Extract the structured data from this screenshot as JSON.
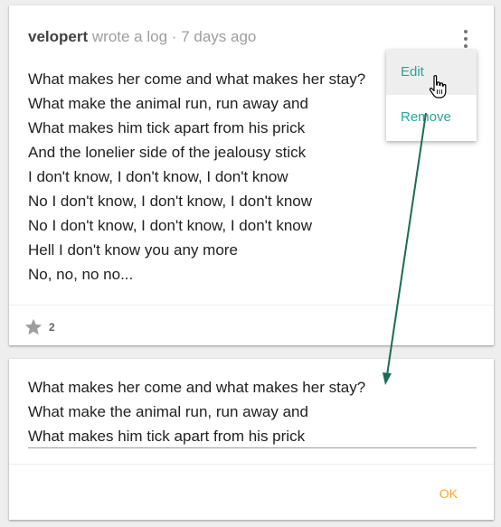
{
  "memo": {
    "author": "velopert",
    "action_text": "wrote a log",
    "separator": "·",
    "time": "7 days ago",
    "lines": [
      "What makes her come and what makes her stay?",
      "What make the animal run, run away and",
      "What makes him tick apart from his prick",
      "And the lonelier side of the jealousy stick",
      "I don't know, I don't know, I don't know",
      "No I don't know, I don't know, I don't know",
      "No I don't know, I don't know, I don't know",
      "Hell I don't know you any more",
      "No, no, no no..."
    ],
    "star_count": "2",
    "menu_icon": "more-vert-icon",
    "star_icon": "star-icon"
  },
  "menu": {
    "edit_label": "Edit",
    "remove_label": "Remove",
    "hovered": "Edit"
  },
  "editor": {
    "lines": [
      "What makes her come and what makes her stay?",
      "What make the animal run, run away and",
      "What makes him tick apart from his prick"
    ],
    "ok_label": "OK"
  },
  "colors": {
    "accent_teal": "#26a69a",
    "ok_orange": "#ffa726",
    "arrow_green": "#1b6b57",
    "background": "#eeeeee"
  }
}
